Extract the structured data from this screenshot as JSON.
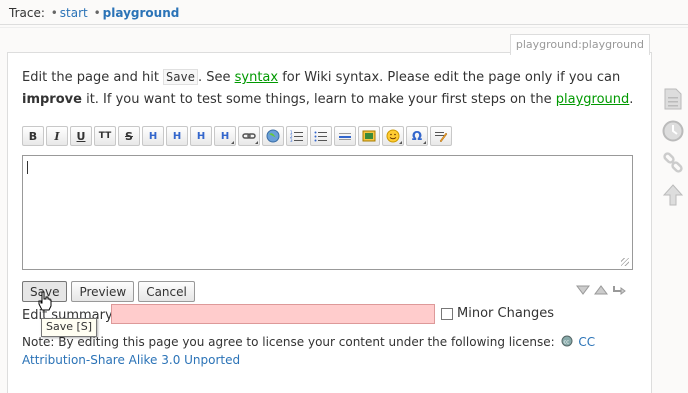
{
  "trace": {
    "label": "Trace:",
    "crumbs": [
      "start",
      "playground"
    ]
  },
  "page": {
    "id": "playground:playground"
  },
  "intro": {
    "part1": "Edit the page and hit ",
    "save_code": "Save",
    "part2": ". See ",
    "syntax_link": "syntax",
    "part3": " for Wiki syntax. Please edit the page only if you can ",
    "improve": "improve",
    "part4": " it. If you want to test some things, learn to make your first steps on the ",
    "playground_link": "playground",
    "part5": "."
  },
  "toolbar": {
    "buttons": [
      {
        "name": "bold-button",
        "label": "B"
      },
      {
        "name": "italic-button",
        "label": "I"
      },
      {
        "name": "underline-button",
        "label": "U"
      },
      {
        "name": "monospace-button",
        "label": "TT"
      },
      {
        "name": "strikethrough-button",
        "label": "S"
      },
      {
        "name": "heading-same-button",
        "label": "H"
      },
      {
        "name": "heading-lower-button",
        "label": "H"
      },
      {
        "name": "heading-higher-button",
        "label": "H"
      },
      {
        "name": "headings-menu-button",
        "label": "H"
      }
    ]
  },
  "editor": {
    "value": ""
  },
  "buttons": {
    "save": "Save",
    "preview": "Preview",
    "cancel": "Cancel"
  },
  "tooltip": "Save [S]",
  "summary": {
    "label": "Edit summary",
    "value": ""
  },
  "minor": {
    "label": "Minor Changes",
    "checked": false
  },
  "license": {
    "text": "Note: By editing this page you agree to license your content under the following license:",
    "link": "CC Attribution-Share Alike 3.0 Unported"
  },
  "colors": {
    "link": "#2b73b7",
    "wikilink": "#009900",
    "summary_bg": "#ffcccc"
  }
}
